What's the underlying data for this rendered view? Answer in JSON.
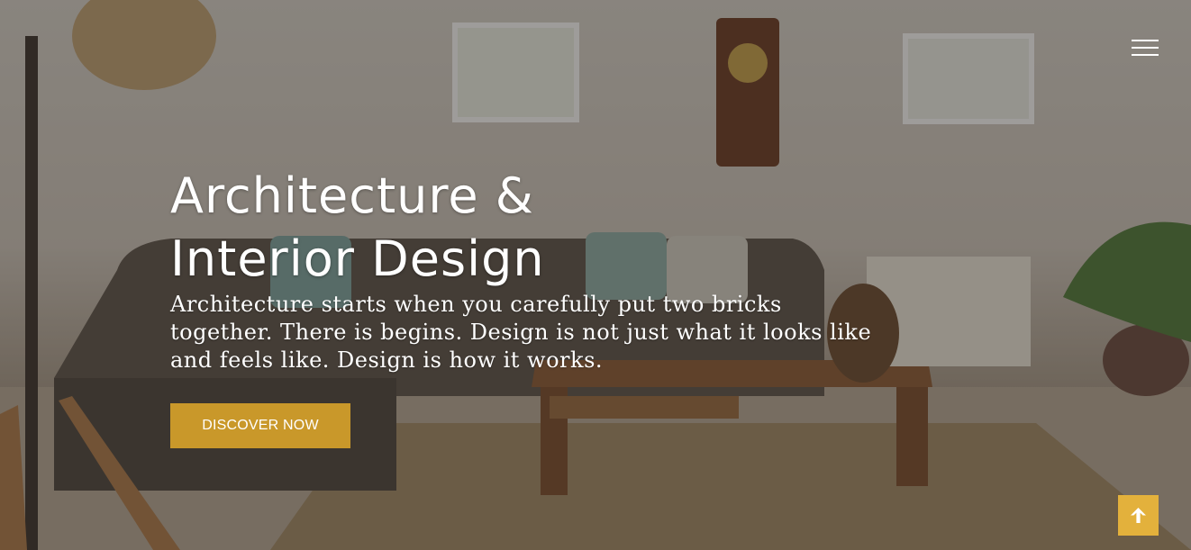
{
  "hero": {
    "headline_line1": "Architecture &",
    "headline_line2": "Interior Design",
    "tagline": "Architecture starts when you carefully put two bricks together. There is begins. Design is not just what it looks like and feels like. Design is how it works.",
    "cta_label": "DISCOVER NOW"
  },
  "nav": {
    "menu_icon": "hamburger-menu-icon"
  },
  "scroll_top": {
    "icon": "arrow-up-icon"
  },
  "colors": {
    "accent": "#c9982a",
    "scroll_top_bg": "#e3b13c",
    "text": "#ffffff",
    "overlay": "rgba(40,36,32,0.45)"
  }
}
